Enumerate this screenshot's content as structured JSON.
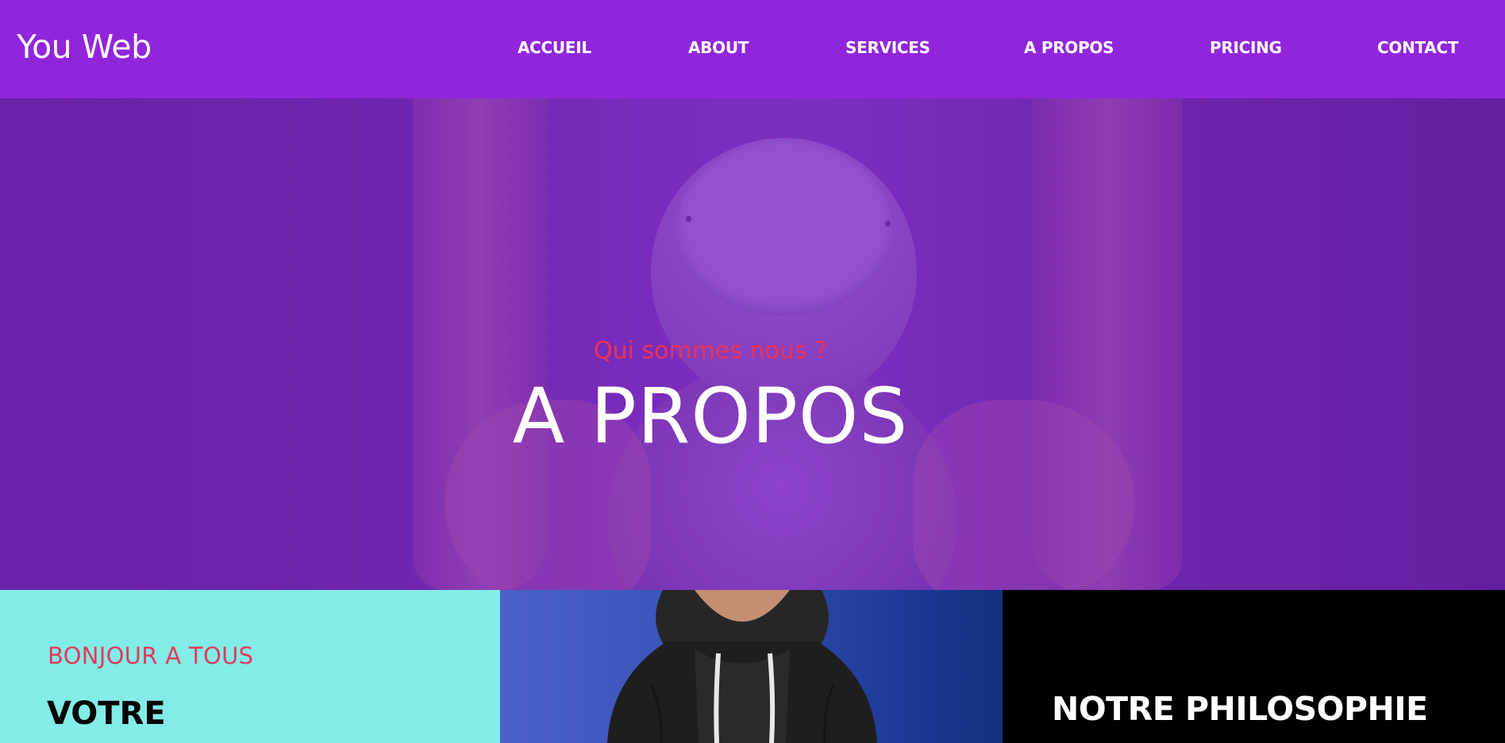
{
  "header": {
    "logo": "You Web",
    "nav": [
      {
        "label": "ACCUEIL"
      },
      {
        "label": "ABOUT"
      },
      {
        "label": "SERVICES"
      },
      {
        "label": "A PROPOS"
      },
      {
        "label": "PRICING"
      },
      {
        "label": "CONTACT"
      }
    ]
  },
  "hero": {
    "subtitle": "Qui sommes nous ?",
    "title": "A PROPOS"
  },
  "panels": {
    "left": {
      "kicker": "BONJOUR A TOUS",
      "heading": "VOTRE"
    },
    "right": {
      "heading": "NOTRE PHILOSOPHIE"
    }
  },
  "colors": {
    "header_bg": "#9125dc",
    "accent_pink": "#e8335a",
    "panel_teal": "#83ece6",
    "panel_blue": "#3650b6",
    "panel_black": "#000000"
  }
}
